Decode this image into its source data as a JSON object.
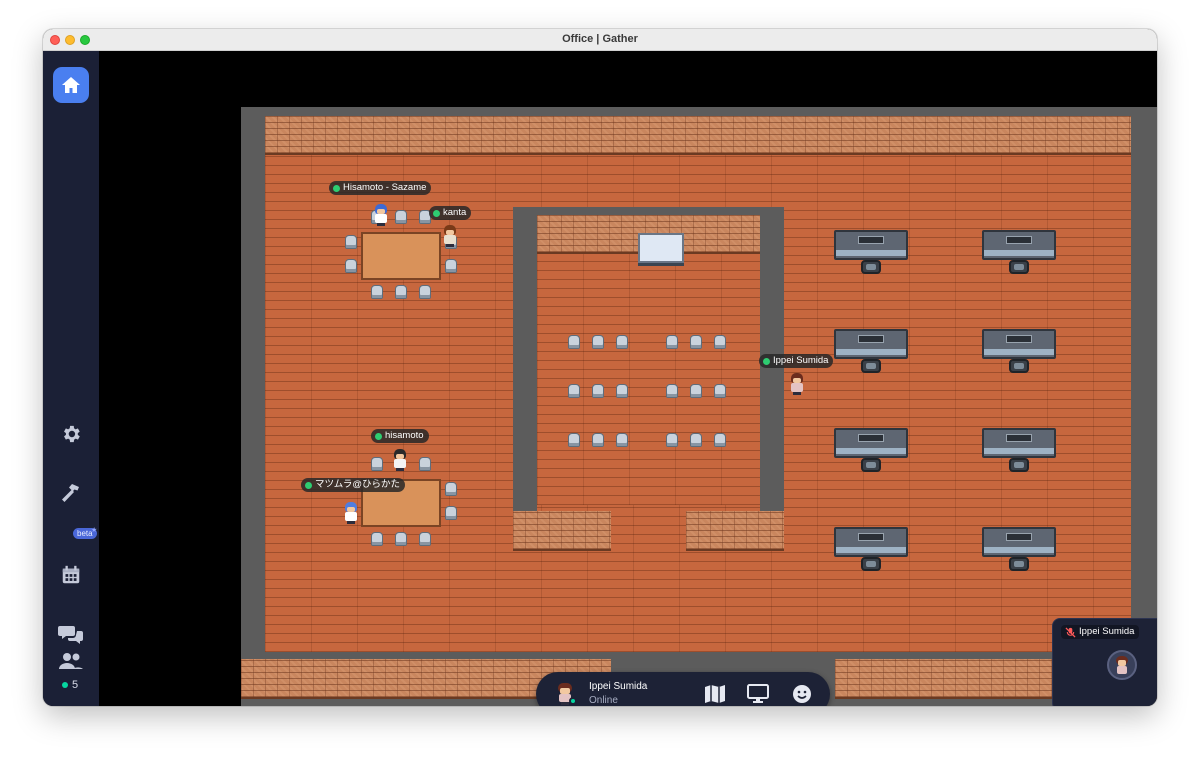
{
  "window": {
    "title": "Office | Gather"
  },
  "sidebar": {
    "items": [
      {
        "name": "home",
        "icon": "home-icon"
      },
      {
        "name": "settings",
        "icon": "gear-icon"
      },
      {
        "name": "build",
        "icon": "hammer-icon"
      },
      {
        "name": "calendar",
        "icon": "calendar-icon",
        "badge": "beta"
      },
      {
        "name": "chat",
        "icon": "chat-bubbles-icon"
      },
      {
        "name": "participants",
        "icon": "people-icon"
      }
    ],
    "online_count": "5"
  },
  "map": {
    "players": [
      {
        "name": "Hisamoto - Sazame"
      },
      {
        "name": "kanta"
      },
      {
        "name": "hisamoto"
      },
      {
        "name": "マツムラ@ひらかた"
      },
      {
        "name": "Ippei Sumida"
      }
    ]
  },
  "bottom_bar": {
    "user_name": "Ippei Sumida",
    "status": "Online",
    "buttons": [
      {
        "name": "map",
        "icon": "map-icon"
      },
      {
        "name": "screen-share",
        "icon": "monitor-icon"
      },
      {
        "name": "emote",
        "icon": "smiley-icon"
      }
    ]
  },
  "video_tile": {
    "name": "Ippei Sumida",
    "mic_icon": "mic-muted-icon"
  },
  "colors": {
    "sidebar_bg": "#1b2036",
    "accent": "#4a7ff0",
    "online": "#06d6a0",
    "floor": "#c7673e",
    "wall": "#5c5c5c"
  }
}
